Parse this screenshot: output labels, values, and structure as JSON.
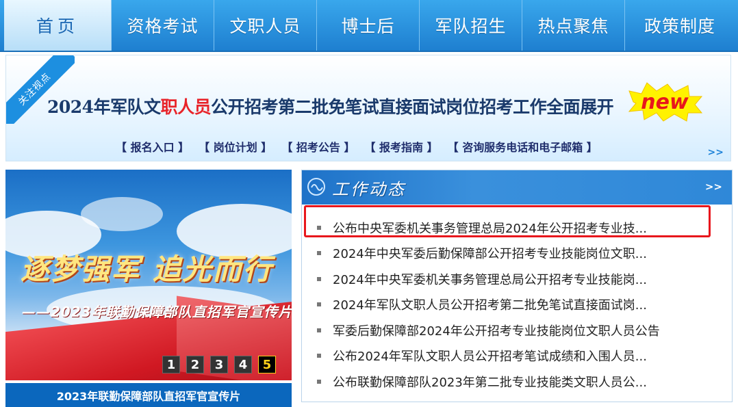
{
  "nav": {
    "items": [
      {
        "label": "首页"
      },
      {
        "label": "资格考试"
      },
      {
        "label": "文职人员"
      },
      {
        "label": "博士后"
      },
      {
        "label": "军队招生"
      },
      {
        "label": "热点聚焦"
      },
      {
        "label": "政策制度"
      }
    ]
  },
  "banner": {
    "ribbon": "关注视点",
    "headline_pre": "2024年军队文",
    "headline_hl": "职人员",
    "headline_post": "公开招考第二批免笔试直接面试岗位招考工作全面展开",
    "badge": "new",
    "links": [
      "【 报名入口 】",
      "【 岗位计划 】",
      "【 招考公告 】",
      "【 报考指南 】",
      "【 咨询服务电话和电子邮箱 】"
    ],
    "more": ">>"
  },
  "slideshow": {
    "slogan": "逐梦强军 追光而行",
    "slogan_sub": "——2023年联勤保障部队直招军官宣传片",
    "pages": [
      "1",
      "2",
      "3",
      "4",
      "5"
    ],
    "active_page": "5",
    "caption": "2023年联勤保障部队直招军官宣传片"
  },
  "news_panel": {
    "title": "工作动态",
    "more": ">>",
    "items": [
      "公布中央军委机关事务管理总局2024年公开招考专业技...",
      "2024年中央军委后勤保障部公开招考专业技能岗位文职...",
      "2024年中央军委机关事务管理总局公开招考专业技能岗...",
      "2024年军队文职人员公开招考第二批免笔试直接面试岗...",
      "军委后勤保障部2024年公开招考专业技能岗位文职人员公告",
      "公布2024年军队文职人员公开招考笔试成绩和入围人员...",
      "公布联勤保障部队2023年第二批专业技能类文职人员公..."
    ]
  },
  "colors": {
    "nav_bg": "#1e7fd0",
    "highlight_border": "#e8161c",
    "headline_red": "#e8242a",
    "caption_bg": "#0b67bd"
  }
}
